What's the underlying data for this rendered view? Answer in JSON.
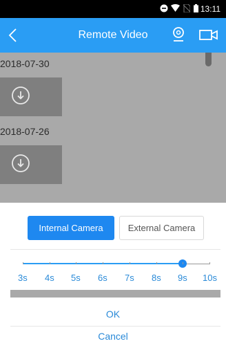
{
  "status_bar": {
    "time": "13:11",
    "icons": [
      "minus-circle-icon",
      "wifi-icon",
      "no-sim-icon",
      "battery-icon"
    ]
  },
  "header": {
    "title": "Remote Video",
    "icons": [
      "back-icon",
      "person-icon",
      "video-camera-icon"
    ],
    "accent_color": "#2a9df4"
  },
  "recordings": [
    {
      "date": "2018-07-30",
      "icon": "download-icon"
    },
    {
      "date": "2018-07-26",
      "icon": "download-icon"
    }
  ],
  "dialog": {
    "camera_options": [
      "Internal Camera",
      "External Camera"
    ],
    "selected_camera": "Internal Camera",
    "duration_labels": [
      "3s",
      "4s",
      "5s",
      "6s",
      "7s",
      "8s",
      "9s",
      "10s"
    ],
    "selected_duration": "9s",
    "ok_label": "OK",
    "cancel_label": "Cancel",
    "active_color": "#1e88f0"
  }
}
